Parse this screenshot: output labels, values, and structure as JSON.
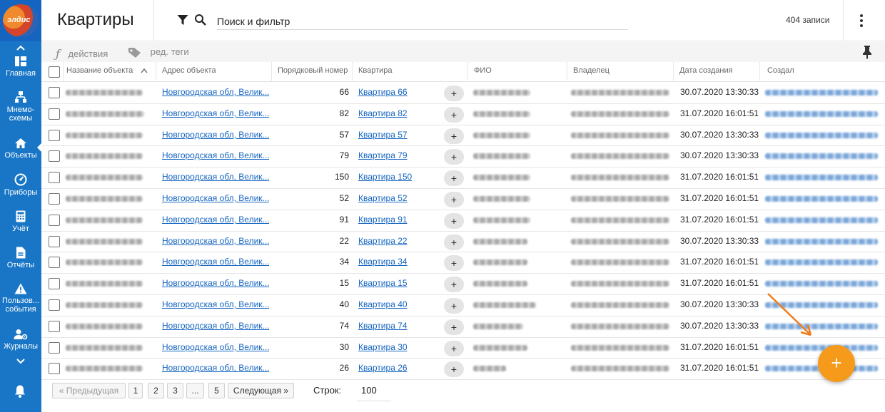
{
  "app": {
    "logo_text": "элдис"
  },
  "sidebar": {
    "items": [
      {
        "label": "Главная",
        "icon": "dashboard-icon"
      },
      {
        "label": "Мнемо-схемы",
        "icon": "diagram-icon"
      },
      {
        "label": "Объекты",
        "icon": "home-icon",
        "active": true
      },
      {
        "label": "Приборы",
        "icon": "gauge-icon"
      },
      {
        "label": "Учёт",
        "icon": "calculator-icon"
      },
      {
        "label": "Отчёты",
        "icon": "document-icon"
      },
      {
        "label": "Пользов... события",
        "icon": "warning-icon"
      },
      {
        "label": "Журналы",
        "icon": "user-settings-icon"
      }
    ]
  },
  "header": {
    "title": "Квартиры",
    "search_placeholder": "Поиск и фильтр",
    "record_count": "404 записи"
  },
  "toolbar": {
    "actions_label": "действия",
    "tags_label": "ред. теги"
  },
  "table": {
    "columns": [
      "Название объекта",
      "Адрес объекта",
      "Порядковый номер",
      "Квартира",
      "ФИО",
      "Владелец",
      "Дата создания",
      "Создал"
    ],
    "rows": [
      {
        "address": "Новгородская обл, Велик...",
        "number": "66",
        "apartment": "Квартира 66",
        "date": "30.07.2020 13:30:33"
      },
      {
        "address": "Новгородская обл, Велик...",
        "number": "82",
        "apartment": "Квартира 82",
        "date": "31.07.2020 16:01:51"
      },
      {
        "address": "Новгородская обл, Велик...",
        "number": "57",
        "apartment": "Квартира 57",
        "date": "30.07.2020 13:30:33"
      },
      {
        "address": "Новгородская обл, Велик...",
        "number": "79",
        "apartment": "Квартира 79",
        "date": "30.07.2020 13:30:33"
      },
      {
        "address": "Новгородская обл, Велик...",
        "number": "150",
        "apartment": "Квартира 150",
        "date": "31.07.2020 16:01:51"
      },
      {
        "address": "Новгородская обл, Велик...",
        "number": "52",
        "apartment": "Квартира 52",
        "date": "31.07.2020 16:01:51"
      },
      {
        "address": "Новгородская обл, Велик...",
        "number": "91",
        "apartment": "Квартира 91",
        "date": "31.07.2020 16:01:51"
      },
      {
        "address": "Новгородская обл, Велик...",
        "number": "22",
        "apartment": "Квартира 22",
        "date": "30.07.2020 13:30:33"
      },
      {
        "address": "Новгородская обл, Велик...",
        "number": "34",
        "apartment": "Квартира 34",
        "date": "31.07.2020 16:01:51"
      },
      {
        "address": "Новгородская обл, Велик...",
        "number": "15",
        "apartment": "Квартира 15",
        "date": "31.07.2020 16:01:51"
      },
      {
        "address": "Новгородская обл, Велик...",
        "number": "40",
        "apartment": "Квартира 40",
        "date": "30.07.2020 13:30:33"
      },
      {
        "address": "Новгородская обл, Велик...",
        "number": "74",
        "apartment": "Квартира 74",
        "date": "30.07.2020 13:30:33"
      },
      {
        "address": "Новгородская обл, Велик...",
        "number": "30",
        "apartment": "Квартира 30",
        "date": "31.07.2020 16:01:51"
      },
      {
        "address": "Новгородская обл, Велик...",
        "number": "26",
        "apartment": "Квартира 26",
        "date": "31.07.2020 16:01:51"
      }
    ],
    "add_button_label": "+"
  },
  "pagination": {
    "prev_label": "« Предыдущая",
    "pages": [
      "1",
      "2",
      "3",
      "...",
      "5"
    ],
    "next_label": "Следующая »",
    "rows_label": "Строк:",
    "rows_value": "100"
  },
  "fab_label": "+",
  "colors": {
    "sidebar": "#1976c6",
    "accent": "#f59a1b",
    "link": "#1565c0"
  }
}
